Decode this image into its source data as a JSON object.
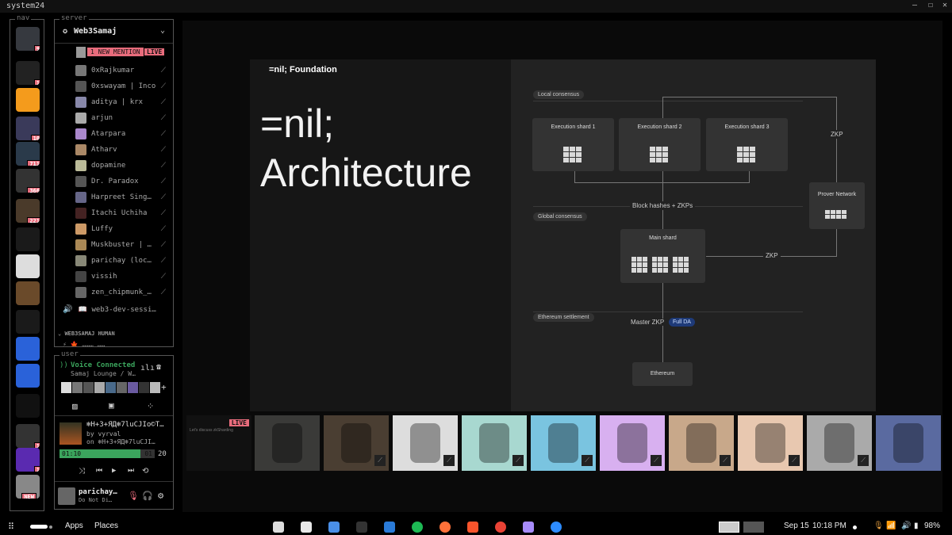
{
  "window": {
    "title": "system24"
  },
  "nav": {
    "label": "nav",
    "items": [
      {
        "name": "discord",
        "badge": "9"
      },
      {
        "name": "server-2",
        "badge": "1"
      },
      {
        "name": "uno",
        "badge": ""
      },
      {
        "name": "folder-group-1",
        "badge": "10"
      },
      {
        "name": "folder-group-2",
        "badge": "711"
      },
      {
        "name": "folder-group-3",
        "badge": "366"
      },
      {
        "name": "folder-group-4",
        "badge": "221"
      },
      {
        "name": "folder",
        "badge": ""
      },
      {
        "name": "server-8",
        "badge": ""
      },
      {
        "name": "india-build",
        "badge": ""
      },
      {
        "name": "triangle",
        "badge": ""
      },
      {
        "name": "shield-server",
        "badge": ""
      },
      {
        "name": "ossu",
        "badge": ""
      },
      {
        "name": "t-server",
        "badge": ""
      },
      {
        "name": "mail-server",
        "badge": "1"
      },
      {
        "name": "devpara",
        "badge": "1"
      },
      {
        "name": "new-server",
        "badge": "NEW"
      }
    ]
  },
  "server": {
    "label": "server",
    "name": "Web3Samaj",
    "new_mention": "1 NEW MENTION",
    "live": "LIVE",
    "members": [
      "0xRajkumar",
      "0xswayam | Inco",
      "aditya | krx",
      "arjun",
      "Atarpara",
      "Atharv",
      "dopamine",
      "Dr. Paradox",
      "Harpreet Sing…",
      "Itachi Uchiha",
      "Luffy",
      "Muskbuster | …",
      "parichay (loc…",
      "vissih",
      "zen_chipmunk_…"
    ],
    "voice_channel": "📖 web3-dev-sessi…",
    "category": "WEB3SAMAJ HUMAN",
    "category_channel_partial": "⚡ 🍁 ……… ……"
  },
  "user": {
    "label": "user",
    "voice_connected": "Voice Connected",
    "voice_location": "Samaj Lounge / W…",
    "track_title": "❄H+3+ЯД❄7luCJIo©T…",
    "track_by": "by vyrval",
    "track_on": "on ❄H+3+ЯД❄7luCJI…",
    "time_elapsed": "01:10",
    "time_total": "01",
    "volume": "20",
    "progress": 0.85,
    "username": "parichay…",
    "status": "Do Not Di…"
  },
  "slide": {
    "brand": "=nil; Foundation",
    "title_line1": "=nil;",
    "title_line2": "Architecture",
    "local_consensus": "Local consensus",
    "shard1": "Execution shard 1",
    "shard2": "Execution shard 2",
    "shard3": "Execution shard 3",
    "zkp_right": "ZKP",
    "prover": "Prover Network",
    "block_hashes": "Block hashes + ZKPs",
    "global_consensus": "Global consensus",
    "main_shard": "Main shard",
    "zkp_mid": "ZKP",
    "eth_settlement": "Ethereum settlement",
    "master_zkp": "Master ZKP",
    "full_da": "Full DA",
    "ethereum": "Ethereum"
  },
  "stream_tile": {
    "live": "LIVE",
    "caption": "Let's discuss zkSharding"
  },
  "taskbar": {
    "apps": "Apps",
    "places": "Places",
    "date": "Sep 15",
    "time": "10:18 PM",
    "battery": "98%"
  },
  "colors": {
    "accent_pink": "#e86c7c",
    "voice_green": "#3ba55d",
    "blue": "#2a62d9"
  }
}
